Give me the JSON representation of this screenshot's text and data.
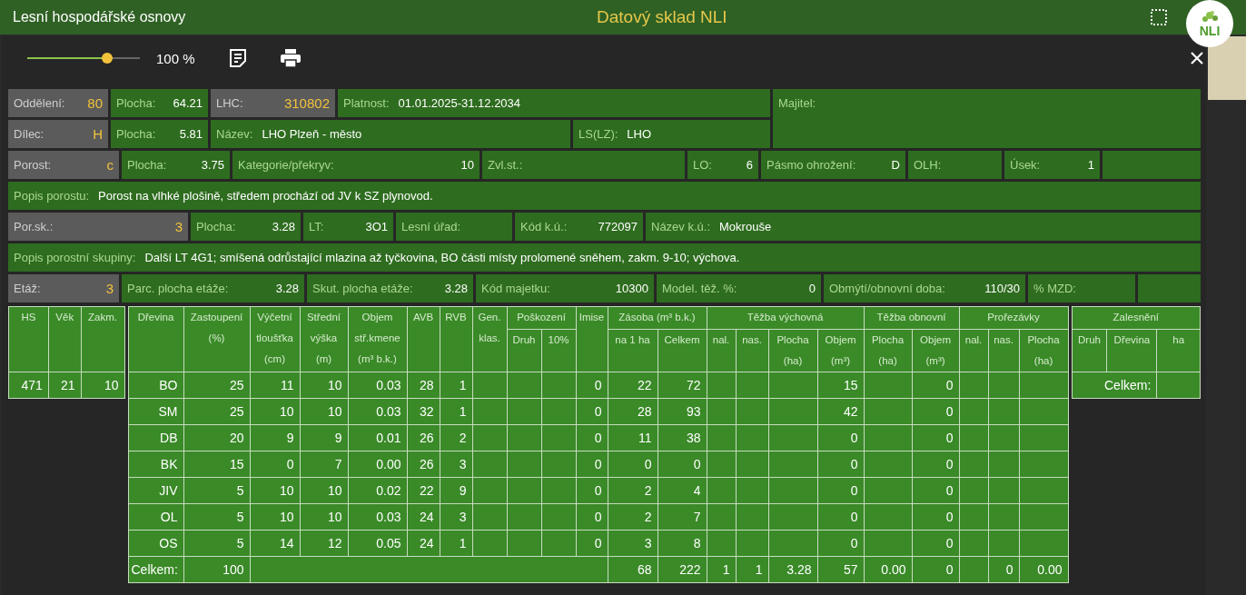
{
  "app_bar": {
    "title": "Lesní hospodářské osnovy",
    "center_title": "Datový sklad NLI",
    "logo_text": "NLI"
  },
  "toolbar": {
    "zoom": {
      "level": 0.71
    },
    "zoom_reading": "100 %"
  },
  "header_fields": [
    [
      {
        "kind": "key",
        "label": "Oddělení:",
        "value": "80"
      },
      {
        "kind": "num",
        "label": "Plocha:",
        "value": "64.21"
      },
      {
        "kind": "key",
        "label": "LHC:",
        "value": "310802"
      },
      {
        "kind": "text",
        "label": "Platnost:",
        "value": "01.01.2025-31.12.2034"
      },
      {
        "kind": "text",
        "label": "Majitel:"
      }
    ],
    [
      {
        "kind": "key",
        "label": "Dílec:",
        "value": "H"
      },
      {
        "kind": "num",
        "label": "Plocha:",
        "value": "5.81"
      },
      {
        "kind": "text",
        "label": "Název:",
        "value": "LHO Plzeň - město"
      },
      {
        "kind": "text",
        "label": "LS(LZ):",
        "value": "LHO"
      }
    ],
    [
      {
        "kind": "key",
        "label": "Porost:",
        "value": "c"
      },
      {
        "kind": "num",
        "label": "Plocha:",
        "value": "3.75"
      },
      {
        "kind": "num",
        "label": "Kategorie/překryv:",
        "value": "10"
      },
      {
        "kind": "text",
        "label": "Zvl.st.:"
      },
      {
        "kind": "num",
        "label": "LO:",
        "value": "6"
      },
      {
        "kind": "num",
        "label": "Pásmo ohrožení:",
        "value": "D"
      },
      {
        "kind": "text",
        "label": "OLH:"
      },
      {
        "kind": "num",
        "label": "Úsek:",
        "value": "1"
      },
      {
        "kind": "blank"
      }
    ],
    [
      {
        "kind": "text",
        "label": "Popis porostu:",
        "value": "Porost na vlhké plošině, středem prochází od JV k SZ plynovod."
      }
    ],
    [
      {
        "kind": "key",
        "label": "Por.sk.:",
        "value": "3"
      },
      {
        "kind": "num",
        "label": "Plocha:",
        "value": "3.28"
      },
      {
        "kind": "num",
        "label": "LT:",
        "value": "3O1"
      },
      {
        "kind": "text",
        "label": "Lesní úřad:"
      },
      {
        "kind": "num",
        "label": "Kód k.ú.:",
        "value": "772097"
      },
      {
        "kind": "text",
        "label": "Název k.ú.:",
        "value": "Mokrouše"
      }
    ],
    [
      {
        "kind": "text",
        "label": "Popis porostní skupiny:",
        "value": "Další LT 4G1; smíšená odrůstající mlazina až tyčkovina, BO části místy prolomené sněhem, zakm. 9-10; výchova."
      }
    ],
    [
      {
        "kind": "key",
        "label": "Etáž:",
        "value": "3"
      },
      {
        "kind": "num",
        "label": "Parc. plocha etáže:",
        "value": "3.28"
      },
      {
        "kind": "num",
        "label": "Skut. plocha etáže:",
        "value": "3.28"
      },
      {
        "kind": "num",
        "label": "Kód majetku:",
        "value": "10300"
      },
      {
        "kind": "num",
        "label": "Model. těž. %:",
        "value": "0"
      },
      {
        "kind": "num",
        "label": "Obmýtí/obnovní doba:",
        "value": "110/30"
      },
      {
        "kind": "text",
        "label": "% MZD:"
      },
      {
        "kind": "blank"
      }
    ]
  ],
  "stand_summary": {
    "columns": [
      "HS",
      "Věk",
      "Zakm."
    ],
    "row": [
      "471",
      "21",
      "10"
    ]
  },
  "species_table": {
    "header_groups": [
      {
        "label": "Dřevina"
      },
      {
        "label": "Zastoupení\n(%)"
      },
      {
        "label": "Výčetní\ntloušťka\n(cm)"
      },
      {
        "label": "Střední\nvýška\n(m)"
      },
      {
        "label": "Objem\nstř.kmene\n(m³ b.k.)"
      },
      {
        "label": "AVB"
      },
      {
        "label": "RVB"
      },
      {
        "label": "Gen.\nklas."
      },
      {
        "label": "Poškození",
        "subcolumns": [
          "Druh",
          "10%"
        ]
      },
      {
        "label": "Imise"
      },
      {
        "label": "Zásoba (m³ b.k.)",
        "subcolumns": [
          "na 1 ha",
          "Celkem"
        ]
      },
      {
        "label": "Těžba výchovná",
        "subcolumns": [
          "nal.",
          "nas.",
          "Plocha\n(ha)",
          "Objem\n(m³)"
        ]
      },
      {
        "label": "Těžba obnovní",
        "subcolumns": [
          "Plocha\n(ha)",
          "Objem\n(m³)"
        ]
      },
      {
        "label": "Prořezávky",
        "subcolumns": [
          "nal.",
          "nas.",
          "Plocha\n(ha)"
        ]
      }
    ],
    "rows": [
      [
        "BO",
        "25",
        "11",
        "10",
        "0.03",
        "28",
        "1",
        null,
        null,
        null,
        "0",
        "22",
        "72",
        null,
        null,
        null,
        "15",
        null,
        "0",
        null,
        null,
        null
      ],
      [
        "SM",
        "25",
        "10",
        "10",
        "0.03",
        "32",
        "1",
        null,
        null,
        null,
        "0",
        "28",
        "93",
        null,
        null,
        null,
        "42",
        null,
        "0",
        null,
        null,
        null
      ],
      [
        "DB",
        "20",
        "9",
        "9",
        "0.01",
        "26",
        "2",
        null,
        null,
        null,
        "0",
        "11",
        "38",
        null,
        null,
        null,
        "0",
        null,
        "0",
        null,
        null,
        null
      ],
      [
        "BK",
        "15",
        "0",
        "7",
        "0.00",
        "26",
        "3",
        null,
        null,
        null,
        "0",
        "0",
        "0",
        null,
        null,
        null,
        "0",
        null,
        "0",
        null,
        null,
        null
      ],
      [
        "JIV",
        "5",
        "10",
        "10",
        "0.02",
        "22",
        "9",
        null,
        null,
        null,
        "0",
        "2",
        "4",
        null,
        null,
        null,
        "0",
        null,
        "0",
        null,
        null,
        null
      ],
      [
        "OL",
        "5",
        "10",
        "10",
        "0.03",
        "24",
        "3",
        null,
        null,
        null,
        "0",
        "2",
        "7",
        null,
        null,
        null,
        "0",
        null,
        "0",
        null,
        null,
        null
      ],
      [
        "OS",
        "5",
        "14",
        "12",
        "0.05",
        "24",
        "1",
        null,
        null,
        null,
        "0",
        "3",
        "8",
        null,
        null,
        null,
        "0",
        null,
        "0",
        null,
        null,
        null
      ]
    ],
    "totals": [
      {
        "kind": "label",
        "text": "Celkem:"
      },
      {
        "kind": "value",
        "text": "100"
      },
      {
        "kind": "merged"
      },
      {
        "kind": "value",
        "text": "68"
      },
      {
        "kind": "value",
        "text": "222"
      },
      {
        "kind": "value",
        "text": "1"
      },
      {
        "kind": "value",
        "text": "1"
      },
      {
        "kind": "value",
        "text": "3.28"
      },
      {
        "kind": "value",
        "text": "57"
      },
      {
        "kind": "value",
        "text": "0.00"
      },
      {
        "kind": "value",
        "text": "0"
      },
      {
        "kind": "blank"
      },
      {
        "kind": "value",
        "text": "0"
      },
      {
        "kind": "value",
        "text": "0.00"
      }
    ]
  },
  "afforestation": {
    "title": "Zalesnění",
    "columns": [
      "Druh",
      "Dřevina",
      "ha"
    ],
    "total_label": "Celkem:"
  }
}
